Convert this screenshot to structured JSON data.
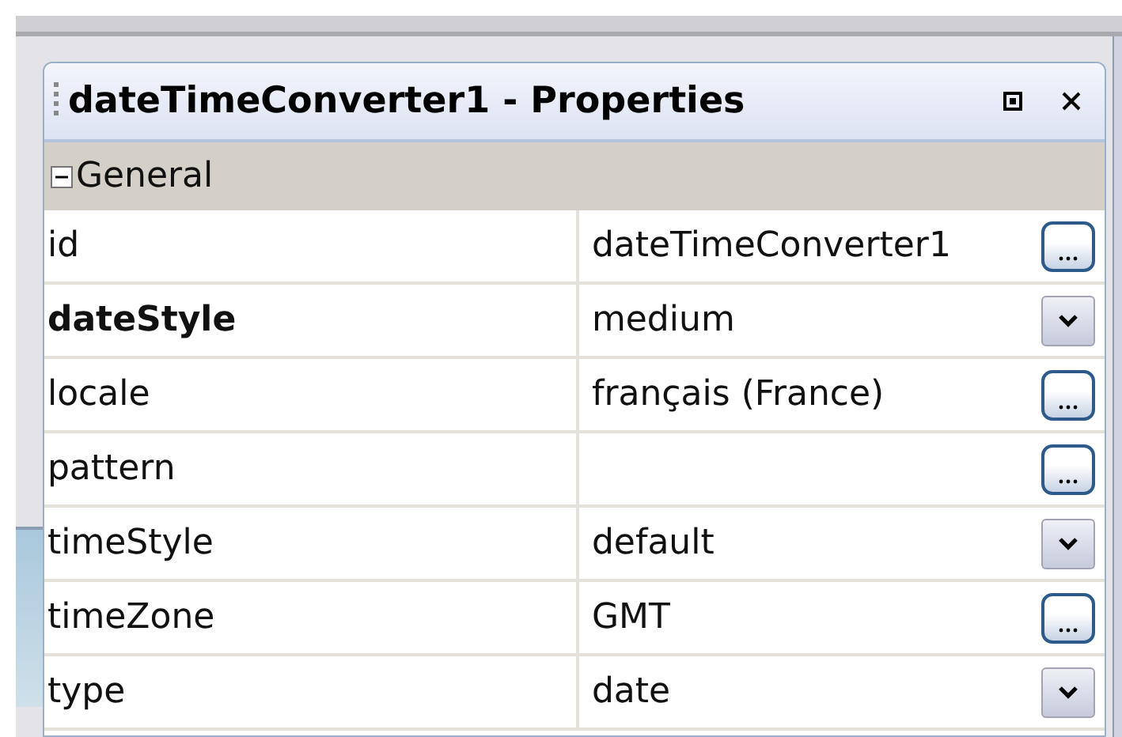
{
  "window": {
    "title": "dateTimeConverter1 - Properties"
  },
  "section": {
    "label": "General",
    "expanded": true
  },
  "properties": [
    {
      "name": "id",
      "value": "dateTimeConverter1",
      "modified": false,
      "kind": "dialog"
    },
    {
      "name": "dateStyle",
      "value": "medium",
      "modified": true,
      "kind": "dropdown"
    },
    {
      "name": "locale",
      "value": "français (France)",
      "modified": false,
      "kind": "dialog"
    },
    {
      "name": "pattern",
      "modified": false,
      "kind": "dialog"
    },
    {
      "name": "timeStyle",
      "value": "default",
      "modified": false,
      "kind": "dropdown"
    },
    {
      "name": "timeZone",
      "value": "GMT",
      "modified": false,
      "kind": "dialog"
    },
    {
      "name": "type",
      "value": "date",
      "modified": false,
      "kind": "dropdown"
    }
  ]
}
